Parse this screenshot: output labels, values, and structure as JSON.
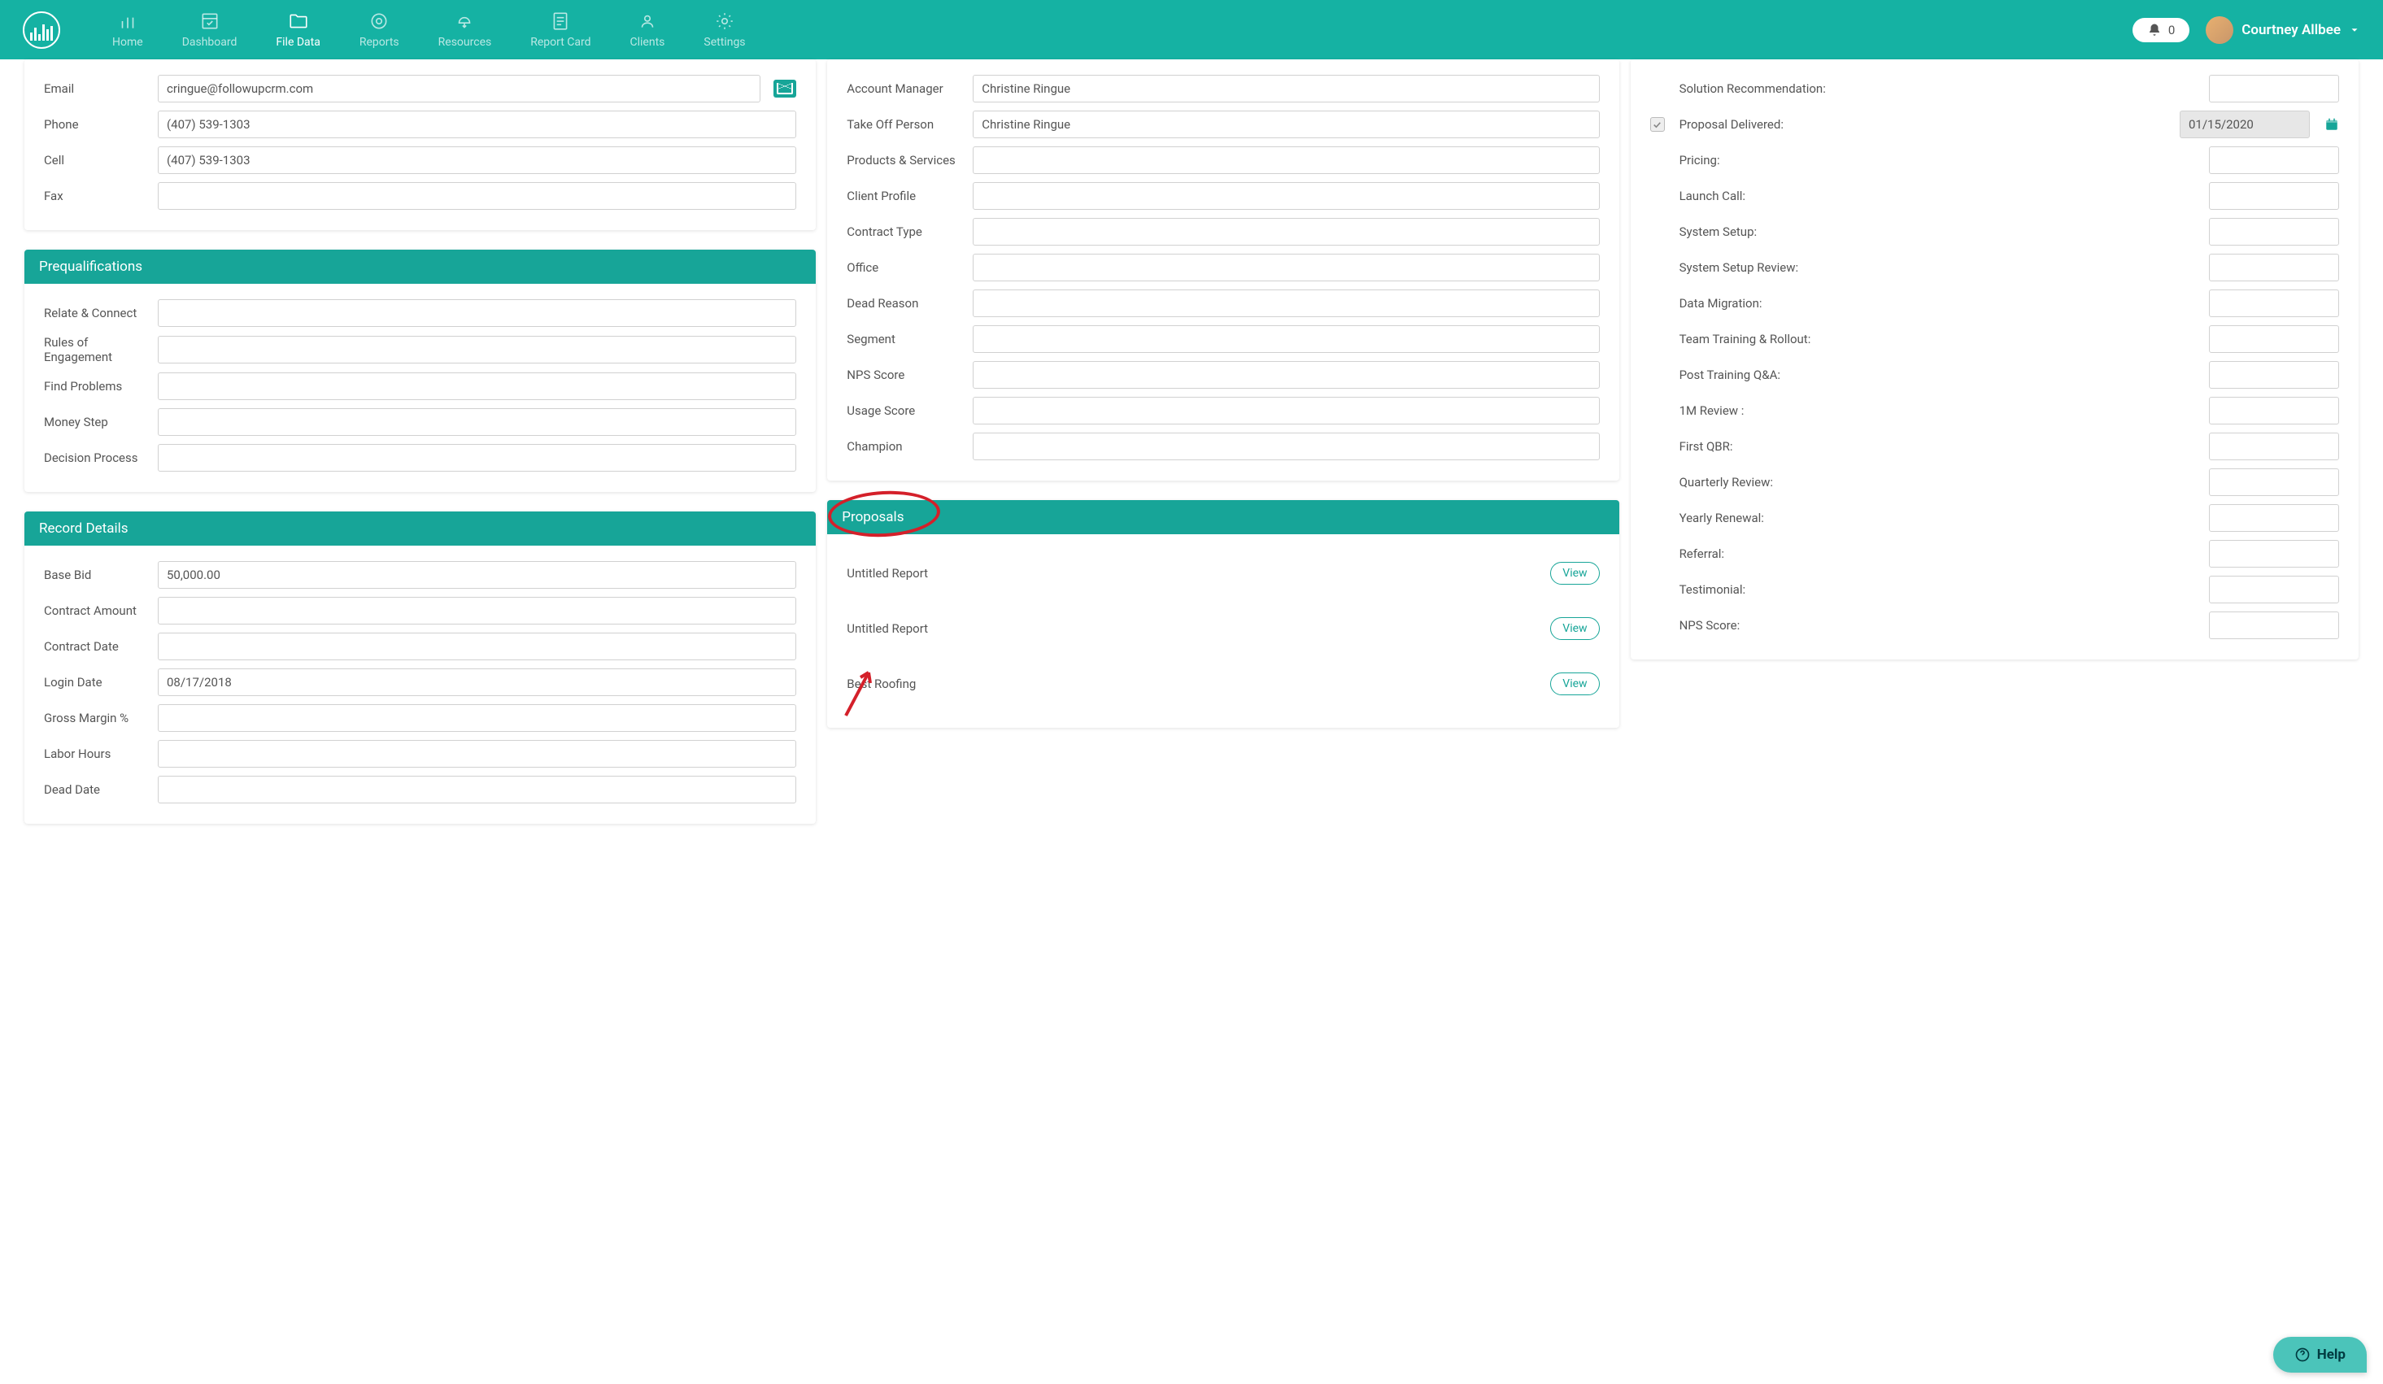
{
  "nav": {
    "home": "Home",
    "dashboard": "Dashboard",
    "fileData": "File Data",
    "reports": "Reports",
    "resources": "Resources",
    "reportCard": "Report Card",
    "clients": "Clients",
    "settings": "Settings"
  },
  "notif_count": "0",
  "user_name": "Courtney Allbee",
  "contact": {
    "email_lbl": "Email",
    "email": "cringue@followupcrm.com",
    "phone_lbl": "Phone",
    "phone": "(407) 539-1303",
    "cell_lbl": "Cell",
    "cell": "(407) 539-1303",
    "fax_lbl": "Fax",
    "fax": ""
  },
  "prequal": {
    "title": "Prequalifications",
    "relate_lbl": "Relate & Connect",
    "relate": "",
    "rules_lbl": "Rules of Engagement",
    "rules": "",
    "find_lbl": "Find Problems",
    "find": "",
    "money_lbl": "Money Step",
    "money": "",
    "decision_lbl": "Decision Process",
    "decision": ""
  },
  "record": {
    "title": "Record Details",
    "base_bid_lbl": "Base Bid",
    "base_bid": "50,000.00",
    "contract_amt_lbl": "Contract Amount",
    "contract_amt": "",
    "contract_date_lbl": "Contract Date",
    "contract_date": "",
    "login_date_lbl": "Login Date",
    "login_date": "08/17/2018",
    "gross_lbl": "Gross Margin %",
    "gross": "",
    "labor_lbl": "Labor Hours",
    "labor": "",
    "dead_lbl": "Dead Date",
    "dead": ""
  },
  "details": {
    "acct_mgr_lbl": "Account Manager",
    "acct_mgr": "Christine Ringue",
    "takeoff_lbl": "Take Off Person",
    "takeoff": "Christine Ringue",
    "products_lbl": "Products & Services",
    "products": "",
    "profile_lbl": "Client Profile",
    "profile": "",
    "contract_type_lbl": "Contract Type",
    "contract_type": "",
    "office_lbl": "Office",
    "office": "",
    "dead_reason_lbl": "Dead Reason",
    "dead_reason": "",
    "segment_lbl": "Segment",
    "segment": "",
    "nps_lbl": "NPS Score",
    "nps": "",
    "usage_lbl": "Usage Score",
    "usage": "",
    "champion_lbl": "Champion",
    "champion": ""
  },
  "proposals": {
    "title": "Proposals",
    "view": "View",
    "items": [
      "Untitled Report",
      "Untitled Report",
      "Best Roofing"
    ]
  },
  "milestones": {
    "solution_lbl": "Solution Recommendation:",
    "solution": "",
    "proposal_lbl": "Proposal Delivered:",
    "proposal": "01/15/2020",
    "pricing_lbl": "Pricing:",
    "pricing": "",
    "launch_lbl": "Launch Call:",
    "launch": "",
    "setup_lbl": "System Setup:",
    "setup": "",
    "setup_rev_lbl": "System Setup Review:",
    "setup_rev": "",
    "migration_lbl": "Data Migration:",
    "migration": "",
    "training_lbl": "Team Training & Rollout:",
    "training": "",
    "qa_lbl": "Post Training Q&A:",
    "qa": "",
    "m1_lbl": "1M Review :",
    "m1": "",
    "qbr_lbl": "First QBR:",
    "qbr": "",
    "qreview_lbl": "Quarterly Review:",
    "qreview": "",
    "renewal_lbl": "Yearly Renewal:",
    "renewal": "",
    "referral_lbl": "Referral:",
    "referral": "",
    "testimonial_lbl": "Testimonial:",
    "testimonial": "",
    "nps2_lbl": "NPS Score:",
    "nps2": ""
  },
  "help": "Help"
}
